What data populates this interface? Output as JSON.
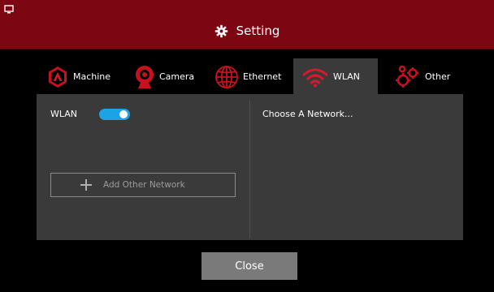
{
  "header": {
    "title": "Setting"
  },
  "tabs": [
    {
      "label": "Machine"
    },
    {
      "label": "Camera"
    },
    {
      "label": "Ethernet"
    },
    {
      "label": "WLAN"
    },
    {
      "label": "Other"
    }
  ],
  "active_tab": "WLAN",
  "wlan": {
    "label": "WLAN",
    "enabled": true,
    "add_network_label": "Add Other Network",
    "choose_network_label": "Choose A Network..."
  },
  "footer": {
    "close_label": "Close"
  },
  "colors": {
    "titlebar": "#7c0713",
    "accent_red": "#d61a2a",
    "toggle_on": "#1ba3e6",
    "panel": "#3a3a3a",
    "button": "#7a7a7a"
  }
}
